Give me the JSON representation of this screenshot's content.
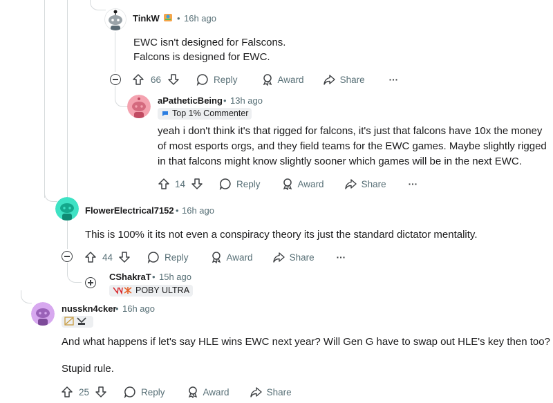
{
  "comments": [
    {
      "author": "TinkW",
      "time": "16h ago",
      "lines": [
        "EWC isn't designed for Falscons.",
        "Falcons is designed for EWC."
      ],
      "votes": "66",
      "actions": {
        "reply": "Reply",
        "award": "Award",
        "share": "Share",
        "more": "···"
      }
    },
    {
      "author": "aPatheticBeing",
      "time": "13h ago",
      "flair": "Top 1% Commenter",
      "lines": [
        "yeah i don't think it's that rigged for falcons, it's just that falcons have 10x the money",
        "of most esports orgs, and they field teams for the EWC games. Maybe slightly rigged",
        "in that falcons might know slightly sooner which games will be in the next EWC."
      ],
      "votes": "14",
      "actions": {
        "reply": "Reply",
        "award": "Award",
        "share": "Share",
        "more": "···"
      }
    },
    {
      "author": "FlowerElectrical7152",
      "time": "16h ago",
      "lines": [
        "This is 100% it its not even a conspiracy theory its just the standard dictator mentality."
      ],
      "votes": "44",
      "actions": {
        "reply": "Reply",
        "award": "Award",
        "share": "Share",
        "more": "···"
      }
    },
    {
      "author": "CShakraT",
      "time": "15h ago",
      "flair": "POBY ULTRA"
    },
    {
      "author": "nusskn4cker",
      "time": "16h ago",
      "lines": [
        "And what happens if let's say HLE wins EWC next year? Will Gen G have to swap out HLE's key then too?",
        "Stupid rule."
      ],
      "votes": "25",
      "actions": {
        "reply": "Reply",
        "award": "Award",
        "share": "Share"
      }
    }
  ],
  "separator": "•",
  "colors": {
    "thread_line": "#d6dadc",
    "meta_text": "#576f76",
    "flair_bg": "#edeff1",
    "avatar_tinkw": "#ffffff",
    "avatar_apathetic": "#f4a3b0",
    "avatar_flower": "#3ee2c4",
    "avatar_nuss": "#d7a8ef"
  }
}
